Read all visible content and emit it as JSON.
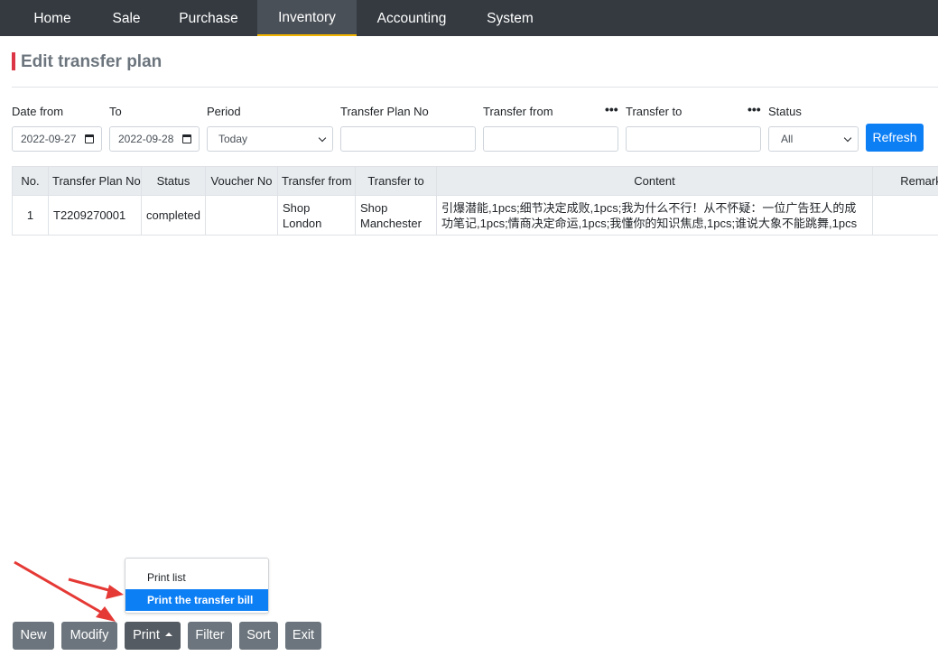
{
  "nav": {
    "items": [
      {
        "label": "Home"
      },
      {
        "label": "Sale"
      },
      {
        "label": "Purchase"
      },
      {
        "label": "Inventory"
      },
      {
        "label": "Accounting"
      },
      {
        "label": "System"
      }
    ],
    "active": "Inventory"
  },
  "page": {
    "title": "Edit transfer plan"
  },
  "filters": {
    "date_from_label": "Date from",
    "date_from_value": "2022-09-27",
    "to_label": "To",
    "to_value": "2022-09-28",
    "period_label": "Period",
    "period_value": "Today",
    "plan_no_label": "Transfer Plan No",
    "plan_no_value": "",
    "transfer_from_label": "Transfer from",
    "transfer_from_value": "",
    "transfer_to_label": "Transfer to",
    "transfer_to_value": "",
    "status_label": "Status",
    "status_value": "All",
    "more_icon": "•••",
    "refresh_label": "Refresh"
  },
  "table": {
    "headers": [
      "No.",
      "Transfer Plan No",
      "Status",
      "Voucher No",
      "Transfer from",
      "Transfer to",
      "Content",
      "Remark"
    ],
    "rows": [
      {
        "no": "1",
        "plan_no": "T2209270001",
        "status": "completed",
        "voucher_no": "",
        "transfer_from": "Shop London",
        "transfer_to": "Shop Manchester",
        "content": "引爆潜能,1pcs;细节决定成败,1pcs;我为什么不行！从不怀疑：一位广告狂人的成功笔记,1pcs;情商决定命运,1pcs;我懂你的知识焦虑,1pcs;谁说大象不能跳舞,1pcs",
        "remark": ""
      }
    ]
  },
  "toolbar": {
    "new_label": "New",
    "modify_label": "Modify",
    "print_label": "Print",
    "filter_label": "Filter",
    "sort_label": "Sort",
    "exit_label": "Exit"
  },
  "print_menu": {
    "items": [
      {
        "label": "Print list"
      },
      {
        "label": "Print the transfer bill"
      }
    ],
    "highlighted": "Print the transfer bill"
  },
  "colors": {
    "nav_bg": "#343a40",
    "accent": "#0d7ff5",
    "title_marker": "#dc3545",
    "annotation_arrow": "#e53935"
  }
}
